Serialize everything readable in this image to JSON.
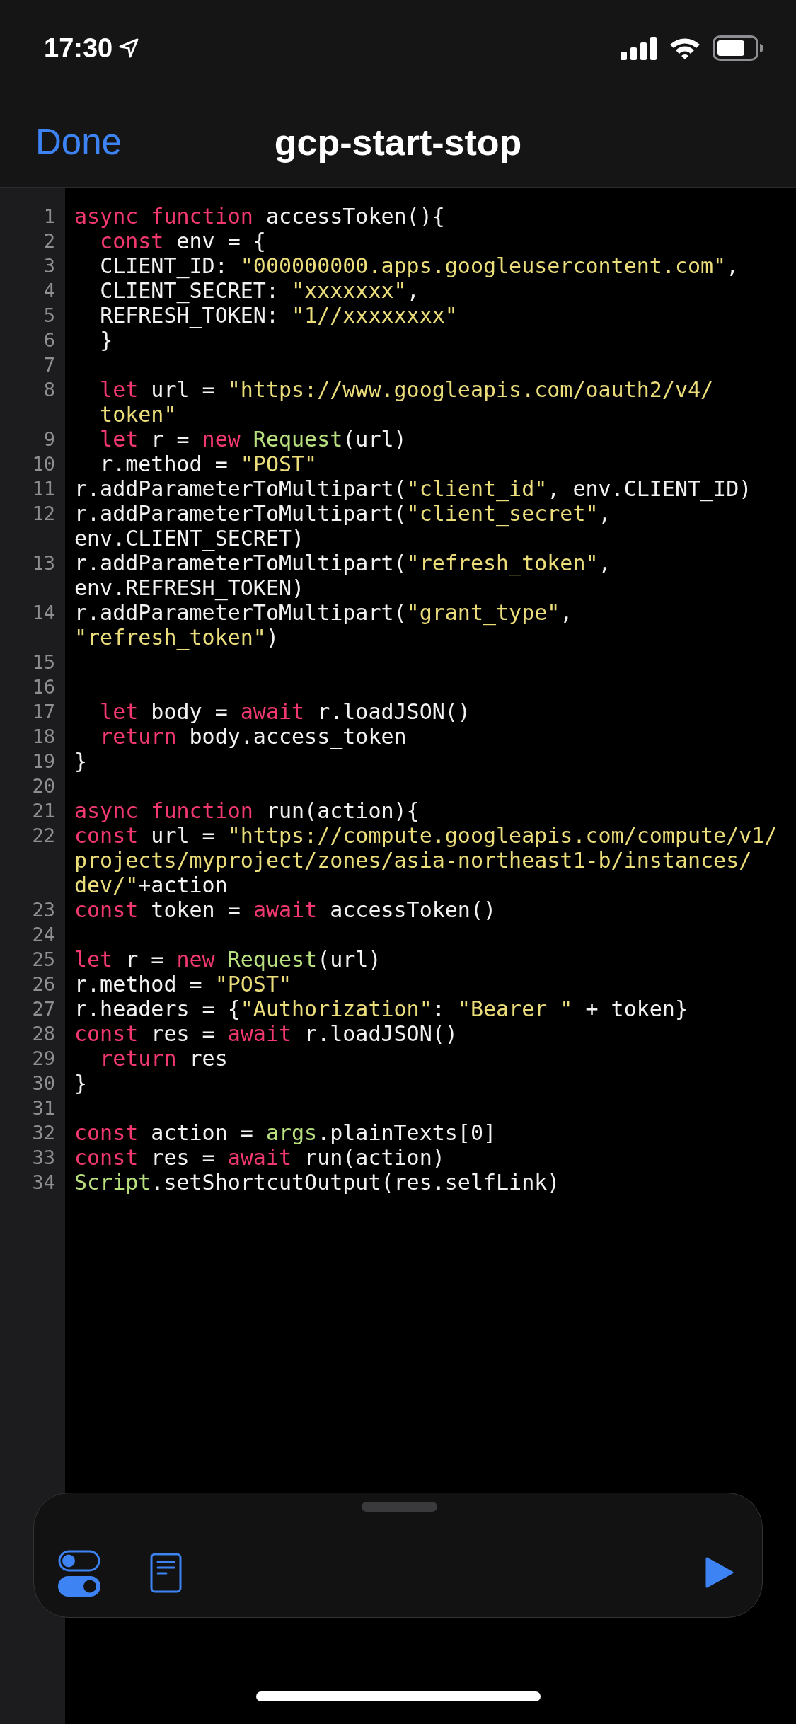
{
  "status_bar": {
    "time": "17:30"
  },
  "nav_bar": {
    "left_button": "Done",
    "title": "gcp-start-stop"
  },
  "editor": {
    "lines": [
      {
        "number": "1",
        "tokens": [
          {
            "kind": "keyword",
            "text": "async function"
          },
          {
            "kind": "plain",
            "text": " accessToken(){"
          }
        ]
      },
      {
        "number": "2",
        "indented": true,
        "tokens": [
          {
            "kind": "keyword",
            "text": "const"
          },
          {
            "kind": "plain",
            "text": " env = {"
          }
        ]
      },
      {
        "number": "3",
        "tokens": [
          {
            "kind": "plain",
            "text": "  CLIENT_ID: "
          },
          {
            "kind": "string",
            "text": "\"000000000.apps.googleusercontent.com\""
          },
          {
            "kind": "plain",
            "text": ","
          }
        ]
      },
      {
        "number": "4",
        "tokens": [
          {
            "kind": "plain",
            "text": "  CLIENT_SECRET: "
          },
          {
            "kind": "string",
            "text": "\"xxxxxxx\""
          },
          {
            "kind": "plain",
            "text": ","
          }
        ]
      },
      {
        "number": "5",
        "tokens": [
          {
            "kind": "plain",
            "text": "  REFRESH_TOKEN: "
          },
          {
            "kind": "string",
            "text": "\"1//xxxxxxxx\""
          }
        ]
      },
      {
        "number": "6",
        "tokens": [
          {
            "kind": "plain",
            "text": "  }"
          }
        ]
      },
      {
        "number": "7"
      },
      {
        "number": "8",
        "indented": true,
        "tokens": [
          {
            "kind": "keyword",
            "text": "let"
          },
          {
            "kind": "plain",
            "text": " url = "
          },
          {
            "kind": "string",
            "text": "\"https://www.googleapis.com/oauth2/v4/token\""
          }
        ]
      },
      {
        "number": "9",
        "indented": true,
        "tokens": [
          {
            "kind": "keyword",
            "text": "let"
          },
          {
            "kind": "plain",
            "text": " r = "
          },
          {
            "kind": "keyword",
            "text": "new "
          },
          {
            "kind": "type",
            "text": "Request"
          },
          {
            "kind": "plain",
            "text": "(url)"
          }
        ]
      },
      {
        "number": "10",
        "tokens": [
          {
            "kind": "plain",
            "text": "  r.method = "
          },
          {
            "kind": "string",
            "text": "\"POST\""
          }
        ]
      },
      {
        "number": "11",
        "tokens": [
          {
            "kind": "plain",
            "text": "r.addParameterToMultipart("
          },
          {
            "kind": "string",
            "text": "\"client_id\""
          },
          {
            "kind": "plain",
            "text": ", env.CLIENT_ID)"
          }
        ]
      },
      {
        "number": "12",
        "tokens": [
          {
            "kind": "plain",
            "text": "r.addParameterToMultipart("
          },
          {
            "kind": "string",
            "text": "\"client_secret\""
          },
          {
            "kind": "plain",
            "text": ", env.CLIENT_SECRET)"
          }
        ]
      },
      {
        "number": "13",
        "tokens": [
          {
            "kind": "plain",
            "text": "r.addParameterToMultipart("
          },
          {
            "kind": "string",
            "text": "\"refresh_token\""
          },
          {
            "kind": "plain",
            "text": ", env.REFRESH_TOKEN)"
          }
        ]
      },
      {
        "number": "14",
        "tokens": [
          {
            "kind": "plain",
            "text": "r.addParameterToMultipart("
          },
          {
            "kind": "string",
            "text": "\"grant_type\""
          },
          {
            "kind": "plain",
            "text": ", "
          },
          {
            "kind": "string",
            "text": "\"refresh_token\""
          },
          {
            "kind": "plain",
            "text": ")"
          }
        ]
      },
      {
        "number": "15"
      },
      {
        "number": "16"
      },
      {
        "number": "17",
        "indented": true,
        "tokens": [
          {
            "kind": "keyword",
            "text": "let"
          },
          {
            "kind": "plain",
            "text": " body = "
          },
          {
            "kind": "keyword",
            "text": "await"
          },
          {
            "kind": "plain",
            "text": " r.loadJSON()"
          }
        ]
      },
      {
        "number": "18",
        "indented": true,
        "tokens": [
          {
            "kind": "keyword",
            "text": "return"
          },
          {
            "kind": "plain",
            "text": " body.access_token"
          }
        ]
      },
      {
        "number": "19",
        "tokens": [
          {
            "kind": "plain",
            "text": "}"
          }
        ]
      },
      {
        "number": "20"
      },
      {
        "number": "21",
        "tokens": [
          {
            "kind": "keyword",
            "text": "async function"
          },
          {
            "kind": "plain",
            "text": " run(action){"
          }
        ]
      },
      {
        "number": "22",
        "tokens": [
          {
            "kind": "keyword",
            "text": "const"
          },
          {
            "kind": "plain",
            "text": " url = "
          },
          {
            "kind": "string",
            "text": "\"https://compute.googleapis.com/compute/v1/projects/myproject/zones/asia-northeast1-b/instances/dev/\""
          },
          {
            "kind": "plain",
            "text": "+action"
          }
        ]
      },
      {
        "number": "23",
        "tokens": [
          {
            "kind": "keyword",
            "text": "const"
          },
          {
            "kind": "plain",
            "text": " token = "
          },
          {
            "kind": "keyword",
            "text": "await"
          },
          {
            "kind": "plain",
            "text": " accessToken()"
          }
        ]
      },
      {
        "number": "24"
      },
      {
        "number": "25",
        "tokens": [
          {
            "kind": "keyword",
            "text": "let"
          },
          {
            "kind": "plain",
            "text": " r = "
          },
          {
            "kind": "keyword",
            "text": "new "
          },
          {
            "kind": "type",
            "text": "Request"
          },
          {
            "kind": "plain",
            "text": "(url)"
          }
        ]
      },
      {
        "number": "26",
        "tokens": [
          {
            "kind": "plain",
            "text": "r.method = "
          },
          {
            "kind": "string",
            "text": "\"POST\""
          }
        ]
      },
      {
        "number": "27",
        "tokens": [
          {
            "kind": "plain",
            "text": "r.headers = {"
          },
          {
            "kind": "string",
            "text": "\"Authorization\""
          },
          {
            "kind": "plain",
            "text": ": "
          },
          {
            "kind": "string",
            "text": "\"Bearer \""
          },
          {
            "kind": "plain",
            "text": " + token}"
          }
        ]
      },
      {
        "number": "28",
        "tokens": [
          {
            "kind": "keyword",
            "text": "const"
          },
          {
            "kind": "plain",
            "text": " res = "
          },
          {
            "kind": "keyword",
            "text": "await"
          },
          {
            "kind": "plain",
            "text": " r.loadJSON()"
          }
        ]
      },
      {
        "number": "29",
        "indented": true,
        "tokens": [
          {
            "kind": "keyword",
            "text": "return"
          },
          {
            "kind": "plain",
            "text": " res"
          }
        ]
      },
      {
        "number": "30",
        "tokens": [
          {
            "kind": "plain",
            "text": "}"
          }
        ]
      },
      {
        "number": "31"
      },
      {
        "number": "32",
        "tokens": [
          {
            "kind": "keyword",
            "text": "const"
          },
          {
            "kind": "plain",
            "text": " action = "
          },
          {
            "kind": "type",
            "text": "args"
          },
          {
            "kind": "plain",
            "text": ".plainTexts[0]"
          }
        ]
      },
      {
        "number": "33",
        "tokens": [
          {
            "kind": "keyword",
            "text": "const"
          },
          {
            "kind": "plain",
            "text": " res = "
          },
          {
            "kind": "keyword",
            "text": "await"
          },
          {
            "kind": "plain",
            "text": " run(action)"
          }
        ]
      },
      {
        "number": "34",
        "tokens": [
          {
            "kind": "type",
            "text": "Script"
          },
          {
            "kind": "plain",
            "text": ".setShortcutOutput(res.selfLink)"
          }
        ]
      }
    ]
  }
}
